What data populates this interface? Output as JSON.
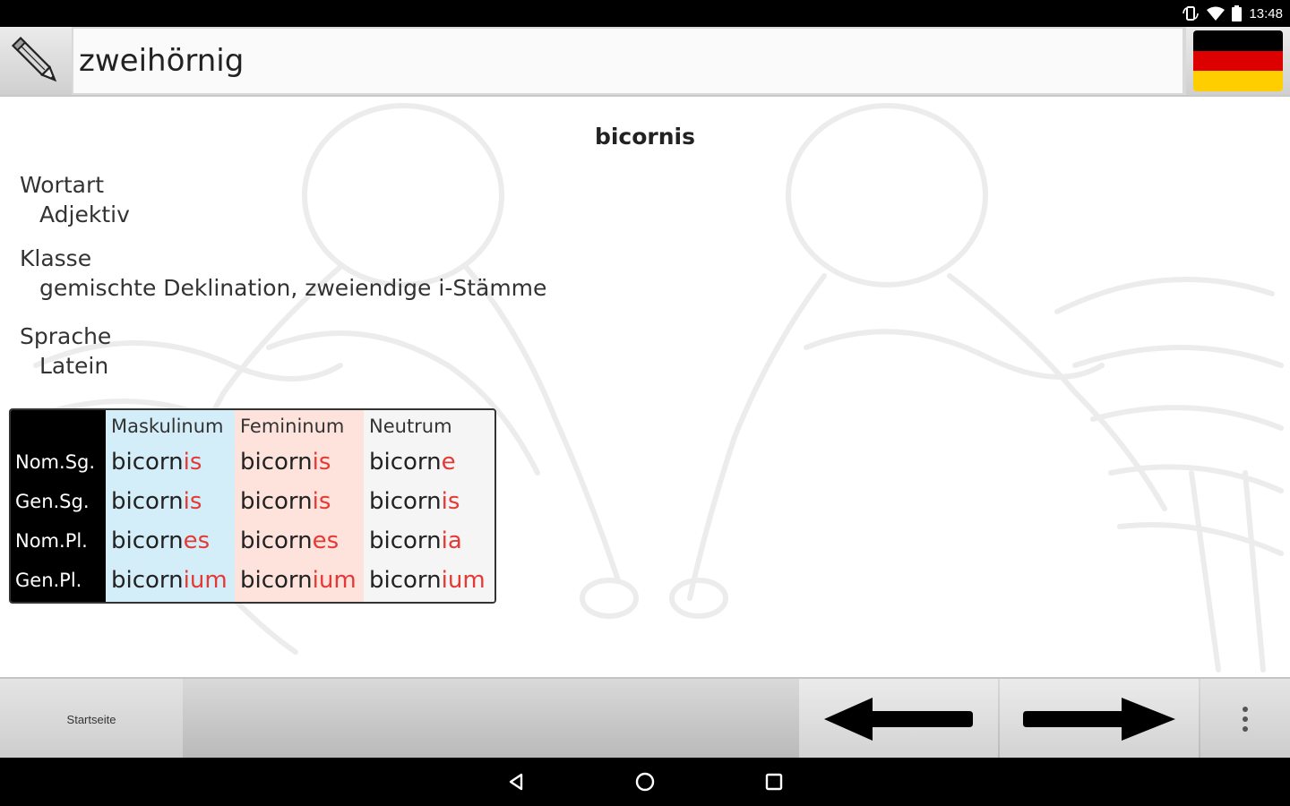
{
  "status": {
    "time": "13:48"
  },
  "search": {
    "value": "zweihörnig"
  },
  "entry": {
    "headword": "bicornis",
    "fields": [
      {
        "label": "Wortart",
        "value": "Adjektiv"
      },
      {
        "label": "Klasse",
        "value": "gemischte Deklination, zweiendige i-Stämme"
      },
      {
        "label": "Sprache",
        "value": "Latein"
      }
    ]
  },
  "declension": {
    "headers": [
      "Maskulinum",
      "Femininum",
      "Neutrum"
    ],
    "cases": [
      "Nom.Sg.",
      "Gen.Sg.",
      "Nom.Pl.",
      "Gen.Pl."
    ],
    "rows": [
      [
        {
          "stem": "bicorn",
          "end": "is"
        },
        {
          "stem": "bicorn",
          "end": "is"
        },
        {
          "stem": "bicorn",
          "end": "e"
        }
      ],
      [
        {
          "stem": "bicorn",
          "end": "is"
        },
        {
          "stem": "bicorn",
          "end": "is"
        },
        {
          "stem": "bicorn",
          "end": "is"
        }
      ],
      [
        {
          "stem": "bicorn",
          "end": "es"
        },
        {
          "stem": "bicorn",
          "end": "es"
        },
        {
          "stem": "bicorn",
          "end": "ia"
        }
      ],
      [
        {
          "stem": "bicorn",
          "end": "ium"
        },
        {
          "stem": "bicorn",
          "end": "ium"
        },
        {
          "stem": "bicorn",
          "end": "ium"
        }
      ]
    ]
  },
  "toolbar": {
    "home_label": "Startseite"
  },
  "colors": {
    "masculine_bg": "#d4eef9",
    "feminine_bg": "#fde3dc",
    "neuter_bg": "#f5f5f5",
    "ending": "#e53935",
    "flag": [
      "#000000",
      "#dd0000",
      "#ffce00"
    ]
  },
  "icons": [
    "pencil-icon",
    "german-flag-icon",
    "back-arrow-icon",
    "forward-arrow-icon",
    "overflow-menu-icon",
    "nav-back-icon",
    "nav-home-icon",
    "nav-recents-icon"
  ]
}
